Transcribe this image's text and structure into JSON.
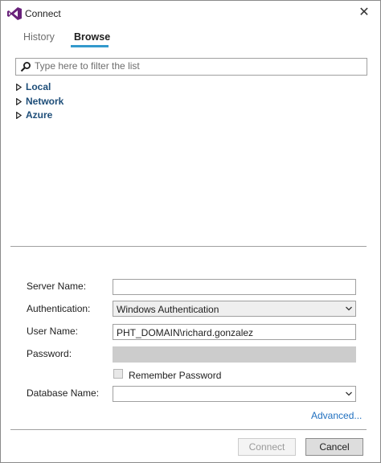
{
  "window": {
    "title": "Connect",
    "close_glyph": "✕"
  },
  "tabs": [
    {
      "label": "History",
      "selected": false
    },
    {
      "label": "Browse",
      "selected": true
    }
  ],
  "filter": {
    "placeholder": "Type here to filter the list",
    "value": ""
  },
  "tree": [
    {
      "label": "Local"
    },
    {
      "label": "Network"
    },
    {
      "label": "Azure"
    }
  ],
  "form": {
    "server_name": {
      "label": "Server Name:",
      "value": ""
    },
    "authentication": {
      "label": "Authentication:",
      "value": "Windows Authentication"
    },
    "user_name": {
      "label": "User Name:",
      "value": "PHT_DOMAIN\\richard.gonzalez"
    },
    "password": {
      "label": "Password:",
      "value": "",
      "disabled": true
    },
    "remember_password": {
      "label": "Remember Password",
      "checked": false
    },
    "database_name": {
      "label": "Database Name:",
      "value": ""
    },
    "advanced_label": "Advanced..."
  },
  "buttons": {
    "connect": "Connect",
    "cancel": "Cancel",
    "connect_enabled": false
  },
  "colors": {
    "accent": "#3399cc",
    "tree_text": "#1e4e79",
    "link": "#1f6fbf",
    "vs_purple": "#68217a"
  },
  "icons": [
    "visual-studio-logo-icon",
    "close-icon",
    "search-icon",
    "expand-arrow-icon",
    "chevron-down-icon"
  ]
}
